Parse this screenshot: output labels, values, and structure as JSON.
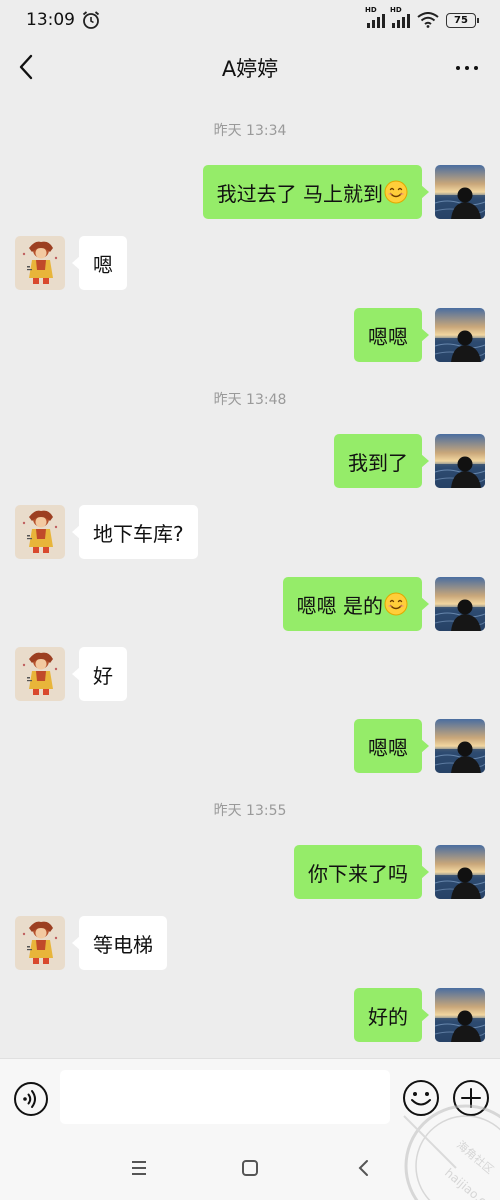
{
  "status_bar": {
    "time": "13:09",
    "sim1": "HD",
    "sim2": "HD",
    "battery": "75",
    "icons": [
      "alarm-icon",
      "signal-icon",
      "signal-icon",
      "wifi-icon",
      "battery-icon"
    ]
  },
  "nav": {
    "title": "A婷婷",
    "back_icon": "chevron-left-icon",
    "more_icon": "more-dots-icon"
  },
  "timestamps": [
    "昨天 13:34",
    "昨天 13:48",
    "昨天 13:55"
  ],
  "messages": [
    {
      "from": "me",
      "text": "我过去了  马上就到",
      "emoji": "smile-emoji"
    },
    {
      "from": "other",
      "text": "嗯"
    },
    {
      "from": "me",
      "text": "嗯嗯"
    },
    {
      "from": "me",
      "text": "我到了"
    },
    {
      "from": "other",
      "text": "地下车库?"
    },
    {
      "from": "me",
      "text": "嗯嗯  是的",
      "emoji": "smile-emoji"
    },
    {
      "from": "other",
      "text": "好"
    },
    {
      "from": "me",
      "text": "嗯嗯"
    },
    {
      "from": "me",
      "text": "你下来了吗"
    },
    {
      "from": "other",
      "text": "等电梯"
    },
    {
      "from": "me",
      "text": "好的"
    }
  ],
  "input": {
    "placeholder": "",
    "value": "",
    "icons": [
      "voice-icon",
      "emoji-icon",
      "plus-icon"
    ]
  },
  "system_nav": {
    "icons": [
      "menu-icon",
      "home-icon",
      "back-icon"
    ]
  },
  "watermark": {
    "text": "海角社区",
    "url": "haijiao.com"
  },
  "colors": {
    "background": "#ededed",
    "my_bubble": "#95ec69",
    "other_bubble": "#ffffff",
    "timestamp": "#9a9a9a"
  }
}
